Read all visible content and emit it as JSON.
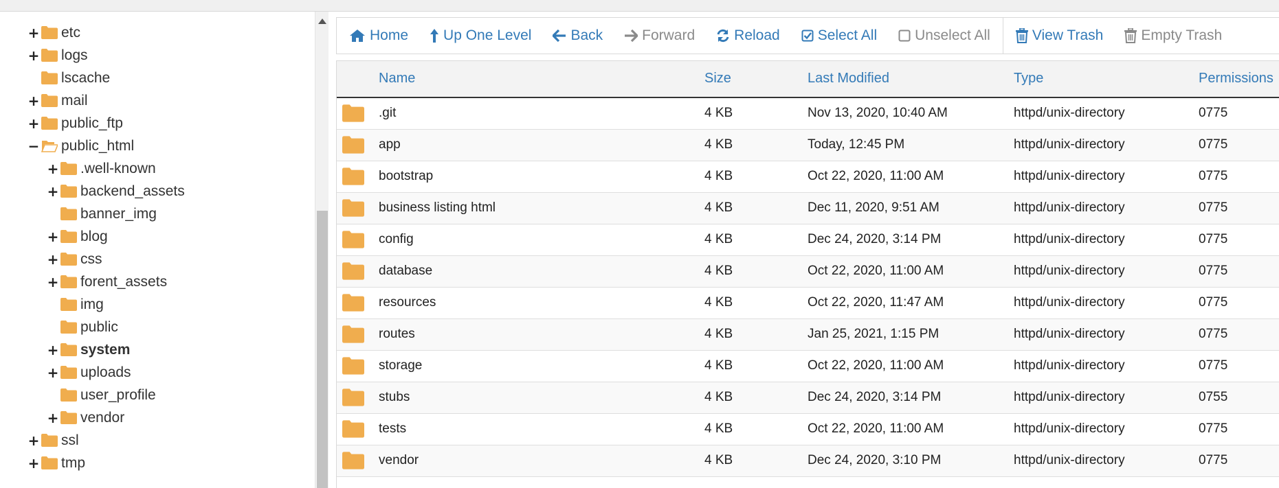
{
  "colors": {
    "accent": "#337ab7",
    "folder": "#f0ad4e",
    "disabled": "#8a8a8a"
  },
  "sidebar": {
    "items": [
      {
        "label": "etc",
        "toggle": "+",
        "depth": 0,
        "bold": false,
        "open": false
      },
      {
        "label": "logs",
        "toggle": "+",
        "depth": 0,
        "bold": false,
        "open": false
      },
      {
        "label": "lscache",
        "toggle": "",
        "depth": 0,
        "bold": false,
        "open": false
      },
      {
        "label": "mail",
        "toggle": "+",
        "depth": 0,
        "bold": false,
        "open": false
      },
      {
        "label": "public_ftp",
        "toggle": "+",
        "depth": 0,
        "bold": false,
        "open": false
      },
      {
        "label": "public_html",
        "toggle": "−",
        "depth": 0,
        "bold": false,
        "open": true
      },
      {
        "label": ".well-known",
        "toggle": "+",
        "depth": 1,
        "bold": false,
        "open": false
      },
      {
        "label": "backend_assets",
        "toggle": "+",
        "depth": 1,
        "bold": false,
        "open": false
      },
      {
        "label": "banner_img",
        "toggle": "",
        "depth": 1,
        "bold": false,
        "open": false
      },
      {
        "label": "blog",
        "toggle": "+",
        "depth": 1,
        "bold": false,
        "open": false
      },
      {
        "label": "css",
        "toggle": "+",
        "depth": 1,
        "bold": false,
        "open": false
      },
      {
        "label": "forent_assets",
        "toggle": "+",
        "depth": 1,
        "bold": false,
        "open": false
      },
      {
        "label": "img",
        "toggle": "",
        "depth": 1,
        "bold": false,
        "open": false
      },
      {
        "label": "public",
        "toggle": "",
        "depth": 1,
        "bold": false,
        "open": false
      },
      {
        "label": "system",
        "toggle": "+",
        "depth": 1,
        "bold": true,
        "open": false
      },
      {
        "label": "uploads",
        "toggle": "+",
        "depth": 1,
        "bold": false,
        "open": false
      },
      {
        "label": "user_profile",
        "toggle": "",
        "depth": 1,
        "bold": false,
        "open": false
      },
      {
        "label": "vendor",
        "toggle": "+",
        "depth": 1,
        "bold": false,
        "open": false
      },
      {
        "label": "ssl",
        "toggle": "+",
        "depth": 0,
        "bold": false,
        "open": false
      },
      {
        "label": "tmp",
        "toggle": "+",
        "depth": 0,
        "bold": false,
        "open": false
      }
    ]
  },
  "toolbar": {
    "buttons": [
      {
        "id": "home",
        "label": "Home",
        "icon": "home-icon",
        "disabled": false
      },
      {
        "id": "up-one-level",
        "label": "Up One Level",
        "icon": "arrow-up-icon",
        "disabled": false
      },
      {
        "id": "back",
        "label": "Back",
        "icon": "arrow-left-icon",
        "disabled": false
      },
      {
        "id": "forward",
        "label": "Forward",
        "icon": "arrow-right-icon",
        "disabled": true
      },
      {
        "id": "reload",
        "label": "Reload",
        "icon": "refresh-icon",
        "disabled": false
      },
      {
        "id": "select-all",
        "label": "Select All",
        "icon": "checked-box-icon",
        "disabled": false
      },
      {
        "id": "unselect-all",
        "label": "Unselect All",
        "icon": "empty-box-icon",
        "disabled": true
      },
      {
        "id": "view-trash",
        "label": "View Trash",
        "icon": "trash-icon",
        "disabled": false
      },
      {
        "id": "empty-trash",
        "label": "Empty Trash",
        "icon": "trash-icon",
        "disabled": true
      }
    ]
  },
  "table": {
    "headers": {
      "name": "Name",
      "size": "Size",
      "modified": "Last Modified",
      "type": "Type",
      "permissions": "Permissions"
    },
    "rows": [
      {
        "name": ".git",
        "size": "4 KB",
        "modified": "Nov 13, 2020, 10:40 AM",
        "type": "httpd/unix-directory",
        "perms": "0775"
      },
      {
        "name": "app",
        "size": "4 KB",
        "modified": "Today, 12:45 PM",
        "type": "httpd/unix-directory",
        "perms": "0775"
      },
      {
        "name": "bootstrap",
        "size": "4 KB",
        "modified": "Oct 22, 2020, 11:00 AM",
        "type": "httpd/unix-directory",
        "perms": "0775"
      },
      {
        "name": "business listing html",
        "size": "4 KB",
        "modified": "Dec 11, 2020, 9:51 AM",
        "type": "httpd/unix-directory",
        "perms": "0775"
      },
      {
        "name": "config",
        "size": "4 KB",
        "modified": "Dec 24, 2020, 3:14 PM",
        "type": "httpd/unix-directory",
        "perms": "0775"
      },
      {
        "name": "database",
        "size": "4 KB",
        "modified": "Oct 22, 2020, 11:00 AM",
        "type": "httpd/unix-directory",
        "perms": "0775"
      },
      {
        "name": "resources",
        "size": "4 KB",
        "modified": "Oct 22, 2020, 11:47 AM",
        "type": "httpd/unix-directory",
        "perms": "0775"
      },
      {
        "name": "routes",
        "size": "4 KB",
        "modified": "Jan 25, 2021, 1:15 PM",
        "type": "httpd/unix-directory",
        "perms": "0775"
      },
      {
        "name": "storage",
        "size": "4 KB",
        "modified": "Oct 22, 2020, 11:00 AM",
        "type": "httpd/unix-directory",
        "perms": "0775"
      },
      {
        "name": "stubs",
        "size": "4 KB",
        "modified": "Dec 24, 2020, 3:14 PM",
        "type": "httpd/unix-directory",
        "perms": "0755"
      },
      {
        "name": "tests",
        "size": "4 KB",
        "modified": "Oct 22, 2020, 11:00 AM",
        "type": "httpd/unix-directory",
        "perms": "0775"
      },
      {
        "name": "vendor",
        "size": "4 KB",
        "modified": "Dec 24, 2020, 3:10 PM",
        "type": "httpd/unix-directory",
        "perms": "0775"
      }
    ]
  }
}
